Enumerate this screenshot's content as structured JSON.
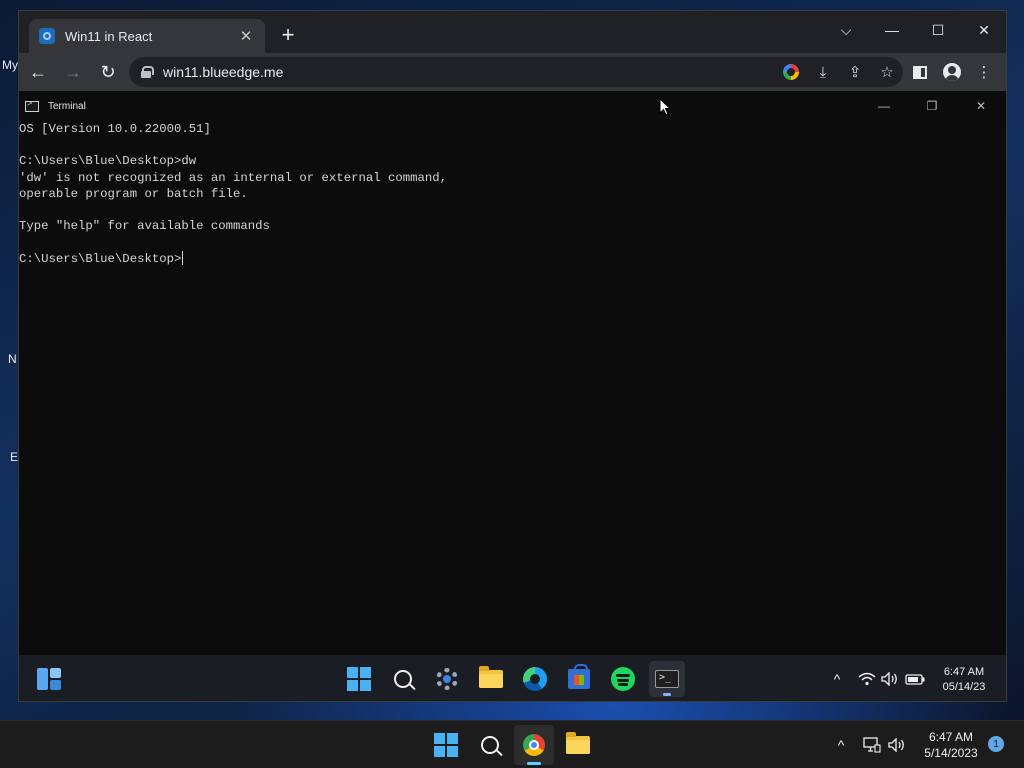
{
  "browser": {
    "tab_title": "Win11 in React",
    "tab_close": "✕",
    "new_tab": "+",
    "url": "win11.blueedge.me",
    "window_controls": {
      "list": "⌵",
      "minimize": "—",
      "maximize": "☐",
      "close": "✕"
    },
    "nav": {
      "back": "←",
      "forward": "→",
      "reload": "↻"
    },
    "toolbar_icons": [
      "google-icon",
      "install-icon",
      "share-icon",
      "bookmark-star-icon",
      "side-panel-icon",
      "profile-icon",
      "menu-icon"
    ]
  },
  "host_desktop": {
    "labels": [
      "My",
      "N",
      "E"
    ]
  },
  "terminal": {
    "title": "Terminal",
    "controls": {
      "minimize": "—",
      "restore": "❐",
      "close": "✕"
    },
    "lines": [
      "OS [Version 10.0.22000.51]",
      "",
      "C:\\Users\\Blue\\Desktop>dw",
      "'dw' is not recognized as an internal or external command,",
      "operable program or batch file.",
      "",
      "Type \"help\" for available commands",
      "",
      "C:\\Users\\Blue\\Desktop>"
    ]
  },
  "inner_taskbar": {
    "apps": [
      "start-icon",
      "search-icon",
      "settings-icon",
      "file-explorer-icon",
      "edge-icon",
      "store-icon",
      "spotify-icon",
      "terminal-icon"
    ],
    "active_app": "terminal-icon",
    "tray": {
      "chevron": "^",
      "wifi": "wifi-icon",
      "volume": "volume-icon",
      "battery": "battery-icon"
    },
    "time": "6:47 AM",
    "date": "05/14/23"
  },
  "host_taskbar": {
    "apps": [
      "start-icon",
      "search-icon",
      "chrome-icon",
      "file-explorer-icon"
    ],
    "active_app": "chrome-icon",
    "tray": {
      "chevron": "^"
    },
    "time": "6:47 AM",
    "date": "5/14/2023",
    "notification_count": "1"
  },
  "colors": {
    "terminal_bg": "#0c0c0c",
    "terminal_text": "#d4d4d4",
    "browser_frame": "#202124",
    "browser_toolbar": "#35363a",
    "accent": "#60cdff"
  }
}
